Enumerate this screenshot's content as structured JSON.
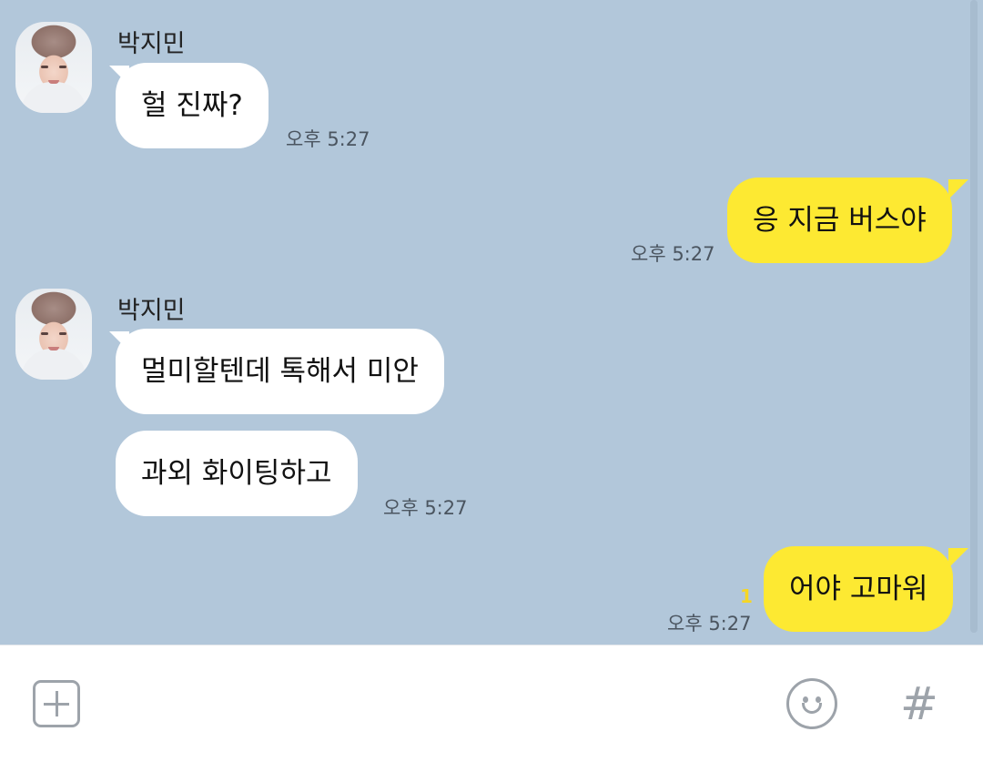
{
  "messages": [
    {
      "from": "friend",
      "sender": "박지민",
      "text": "헐 진짜?",
      "time": "오후 5:27"
    },
    {
      "from": "me",
      "text": "응 지금 버스야",
      "time": "오후 5:27"
    },
    {
      "from": "friend",
      "sender": "박지민",
      "text": "멀미할텐데 톡해서 미안"
    },
    {
      "from": "friend",
      "text": "과외 화이팅하고",
      "time": "오후 5:27"
    },
    {
      "from": "me",
      "text": "어야 고마워",
      "time": "오후 5:27",
      "unread": "1"
    }
  ],
  "input_bar": {
    "attach_icon": "plus-square-icon",
    "emoji_icon": "smiley-icon",
    "hash_label": "#"
  },
  "colors": {
    "background": "#b2c7da",
    "incoming_bubble": "#ffffff",
    "outgoing_bubble": "#fde932"
  }
}
